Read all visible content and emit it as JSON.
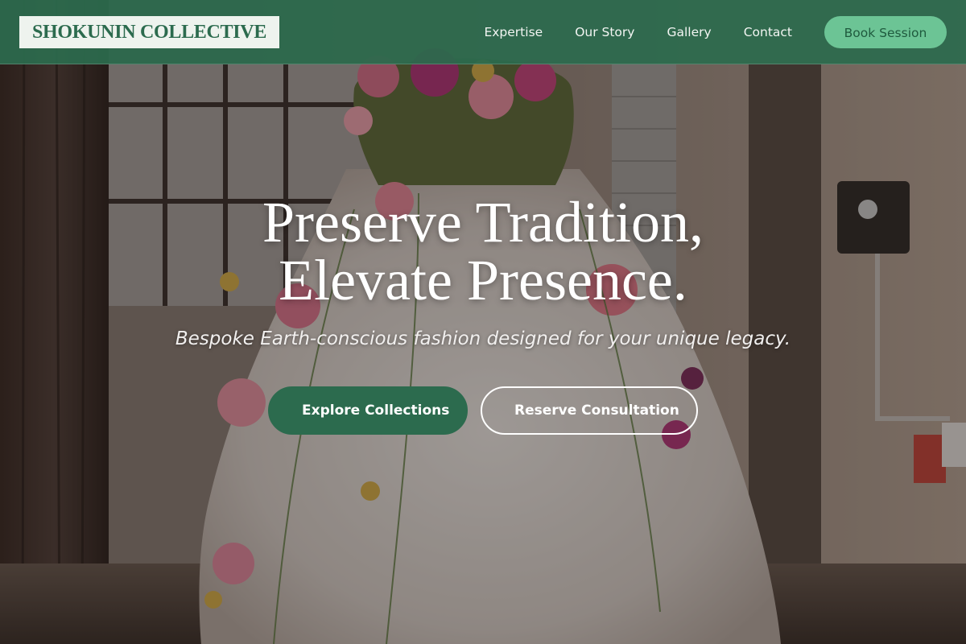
{
  "header": {
    "logo_text": "SHOKUNIN COLLECTIVE",
    "nav": [
      {
        "label": "Expertise"
      },
      {
        "label": "Our Story"
      },
      {
        "label": "Gallery"
      },
      {
        "label": "Contact"
      }
    ],
    "cta_label": "Book Session"
  },
  "hero": {
    "headline_line1": "Preserve Tradition,",
    "headline_line2": "Elevate Presence.",
    "subheadline": "Bespoke Earth-conscious fashion designed for your unique legacy.",
    "primary_cta": "Explore Collections",
    "secondary_cta": "Reserve Consultation",
    "background_image": "floral-adorned-dress-form-in-studio"
  },
  "colors": {
    "brand_green": "#2c6b4e",
    "accent_green": "#6cc495",
    "logo_background": "#eef3ee",
    "text_light": "#ffffff"
  }
}
